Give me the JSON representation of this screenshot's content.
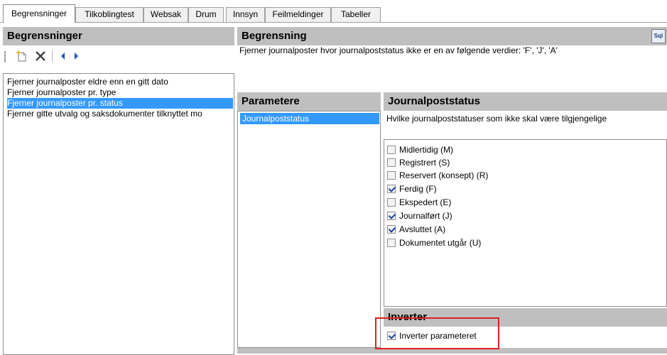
{
  "tabs": [
    {
      "label": "Begrensninger",
      "active": true
    },
    {
      "label": "Tilkoblingtest",
      "active": false
    },
    {
      "label": "Websak",
      "active": false
    },
    {
      "label": "Drum",
      "active": false
    },
    {
      "label": "Innsyn",
      "active": false
    },
    {
      "label": "Feilmeldinger",
      "active": false
    },
    {
      "label": "Tabeller",
      "active": false
    }
  ],
  "left_panel": {
    "title": "Begrensninger",
    "toolbar": {
      "new_icon": "new-item-icon",
      "delete_icon": "delete-x-icon",
      "prev_icon": "arrow-left-icon",
      "next_icon": "arrow-right-icon"
    },
    "items": [
      {
        "label": "Fjerner journalposter eldre enn en gitt dato",
        "selected": false
      },
      {
        "label": "Fjerner journalposter pr. type",
        "selected": false
      },
      {
        "label": "Fjerner journalposter pr. status",
        "selected": true
      },
      {
        "label": "Fjerner gitte utvalg og saksdokumenter tilknyttet mo",
        "selected": false
      }
    ]
  },
  "begrensning": {
    "title": "Begrensning",
    "sql_button": "Sql",
    "description": "Fjerner journalposter hvor journalpoststatus ikke er en av følgende verdier: 'F', 'J', 'A'"
  },
  "parametere": {
    "title": "Parametere",
    "items": [
      {
        "label": "Journalpoststatus",
        "selected": true
      }
    ]
  },
  "journalpoststatus": {
    "title": "Journalpoststatus",
    "description": "Hvilke journalpoststatuser som ikke skal være tilgjengelige",
    "options": [
      {
        "label": "Midlertidig (M)",
        "checked": false
      },
      {
        "label": "Registrert (S)",
        "checked": false
      },
      {
        "label": "Reservert (konsept) (R)",
        "checked": false
      },
      {
        "label": "Ferdig (F)",
        "checked": true
      },
      {
        "label": "Ekspedert (E)",
        "checked": false
      },
      {
        "label": "Journalført (J)",
        "checked": true
      },
      {
        "label": "Avsluttet (A)",
        "checked": true
      },
      {
        "label": "Dokumentet utgår (U)",
        "checked": false
      }
    ]
  },
  "inverter": {
    "title": "Inverter",
    "checkbox_label": "Inverter parameteret",
    "checked": true
  },
  "colors": {
    "header_bg": "#bfbfbf",
    "selection": "#3399ff",
    "highlight_box": "#e02020"
  }
}
